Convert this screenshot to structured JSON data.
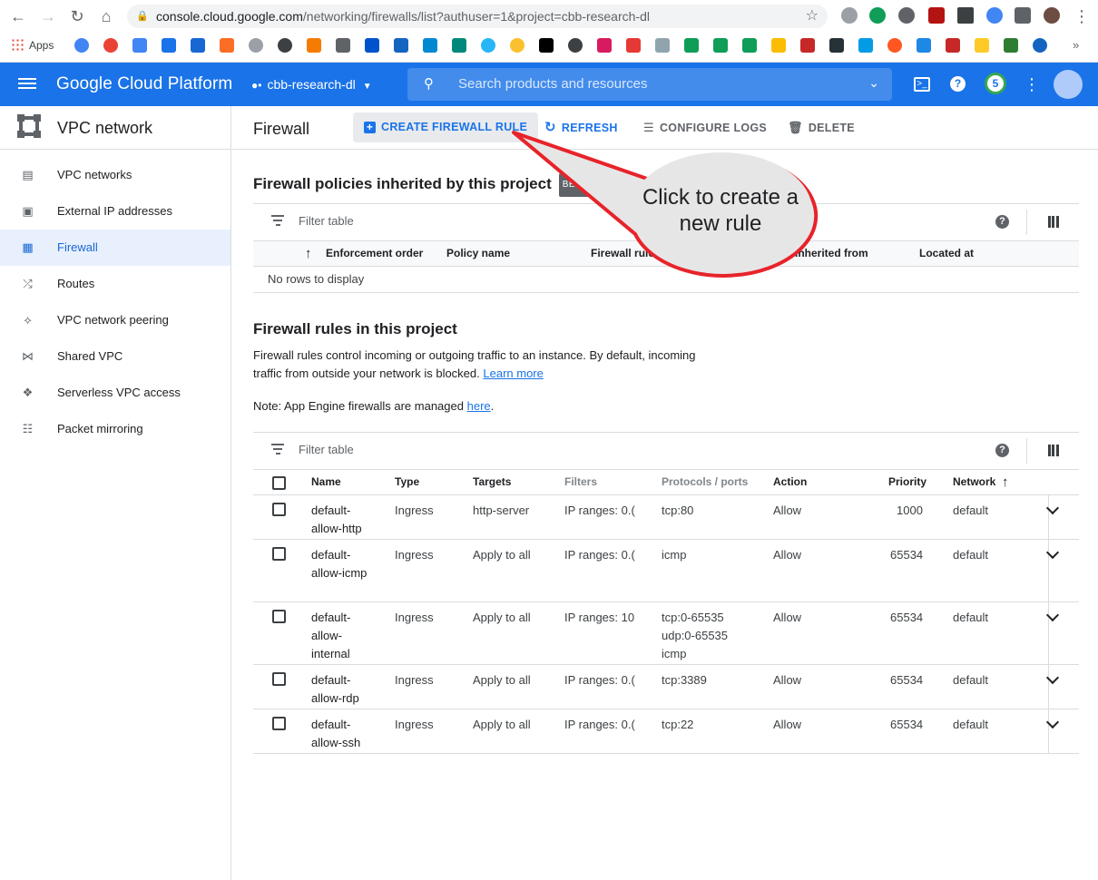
{
  "browser": {
    "url_host": "console.cloud.google.com",
    "url_path": "/networking/firewalls/list?authuser=1&project=cbb-research-dl",
    "apps_label": "Apps"
  },
  "header": {
    "brand": "Google Cloud Platform",
    "project": "cbb-research-dl",
    "search_placeholder": "Search products and resources",
    "notification_count": "5"
  },
  "sidebar": {
    "title": "VPC network",
    "items": [
      {
        "label": "VPC networks",
        "icon": "vpc-networks-icon"
      },
      {
        "label": "External IP addresses",
        "icon": "external-ip-icon"
      },
      {
        "label": "Firewall",
        "icon": "firewall-icon",
        "active": true
      },
      {
        "label": "Routes",
        "icon": "routes-icon"
      },
      {
        "label": "VPC network peering",
        "icon": "peering-icon"
      },
      {
        "label": "Shared VPC",
        "icon": "shared-vpc-icon"
      },
      {
        "label": "Serverless VPC access",
        "icon": "serverless-icon"
      },
      {
        "label": "Packet mirroring",
        "icon": "packet-mirroring-icon"
      }
    ]
  },
  "toolbar": {
    "page_title": "Firewall",
    "create": "CREATE FIREWALL RULE",
    "refresh": "REFRESH",
    "configure_logs": "CONFIGURE LOGS",
    "delete": "DELETE"
  },
  "policies": {
    "title": "Firewall policies inherited by this project",
    "badge": "BETA",
    "filter_label": "Filter table",
    "columns": [
      "Enforcement order",
      "Policy name",
      "Firewall rules",
      "Inherited from",
      "Located at"
    ],
    "empty": "No rows to display"
  },
  "rules": {
    "title": "Firewall rules in this project",
    "description": "Firewall rules control incoming or outgoing traffic to an instance. By default, incoming traffic from outside your network is blocked.",
    "learn_more": "Learn more",
    "note_prefix": "Note: App Engine firewalls are managed",
    "note_link": "here",
    "note_suffix": ".",
    "filter_label": "Filter table",
    "columns": {
      "name": "Name",
      "type": "Type",
      "targets": "Targets",
      "filters": "Filters",
      "protocols": "Protocols / ports",
      "action": "Action",
      "priority": "Priority",
      "network": "Network"
    },
    "rows": [
      {
        "name": "default-allow-http",
        "type": "Ingress",
        "targets": "http-server",
        "filters": "IP ranges: 0.(",
        "protocols": [
          "tcp:80"
        ],
        "action": "Allow",
        "priority": "1000",
        "network": "default"
      },
      {
        "name": "default-allow-icmp",
        "type": "Ingress",
        "targets": "Apply to all",
        "filters": "IP ranges: 0.(",
        "protocols": [
          "icmp"
        ],
        "action": "Allow",
        "priority": "65534",
        "network": "default"
      },
      {
        "name": "default-allow-internal",
        "type": "Ingress",
        "targets": "Apply to all",
        "filters": "IP ranges: 10",
        "protocols": [
          "tcp:0-65535",
          "udp:0-65535",
          "icmp"
        ],
        "action": "Allow",
        "priority": "65534",
        "network": "default"
      },
      {
        "name": "default-allow-rdp",
        "type": "Ingress",
        "targets": "Apply to all",
        "filters": "IP ranges: 0.(",
        "protocols": [
          "tcp:3389"
        ],
        "action": "Allow",
        "priority": "65534",
        "network": "default"
      },
      {
        "name": "default-allow-ssh",
        "type": "Ingress",
        "targets": "Apply to all",
        "filters": "IP ranges: 0.(",
        "protocols": [
          "tcp:22"
        ],
        "action": "Allow",
        "priority": "65534",
        "network": "default"
      }
    ]
  },
  "annotation": {
    "text": "Click to create a new rule",
    "color": "#e8232a"
  },
  "colors": {
    "brand_blue": "#1a73e8",
    "active_bg": "#e8f0fe"
  }
}
